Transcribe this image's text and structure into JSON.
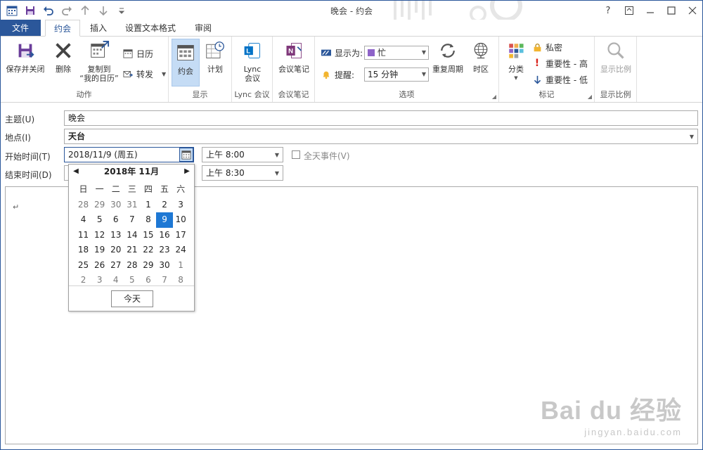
{
  "window": {
    "title": "晚会 - 约会"
  },
  "title_controls": {
    "help": "?"
  },
  "tabs": {
    "file": "文件",
    "appointment": "约会",
    "insert": "插入",
    "format_text": "设置文本格式",
    "review": "审阅"
  },
  "ribbon": {
    "actions": {
      "save_close": "保存并关闭",
      "delete": "删除",
      "copy_to_line1": "复制到",
      "copy_to_line2": "“我的日历”",
      "calendar": "日历",
      "forward": "转发",
      "group_label": "动作"
    },
    "show": {
      "appointment": "约会",
      "schedule": "计划",
      "group_label": "显示"
    },
    "lync": {
      "meeting_line1": "Lync",
      "meeting_line2": "会议",
      "group_label": "Lync 会议"
    },
    "notes": {
      "meeting_notes": "会议笔记",
      "group_label": "会议笔记"
    },
    "options": {
      "show_as_label": "显示为:",
      "show_as_value": "忙",
      "reminder_label": "提醒:",
      "reminder_value": "15 分钟",
      "recurrence": "重复周期",
      "timezone": "时区",
      "group_label": "选项"
    },
    "tags": {
      "categorize": "分类",
      "private": "私密",
      "high_importance": "重要性 - 高",
      "low_importance": "重要性 - 低",
      "group_label": "标记"
    },
    "zoom": {
      "zoom": "显示比例",
      "group_label": "显示比例"
    }
  },
  "form": {
    "subject_label": "主题(U)",
    "subject_value": "晚会",
    "location_label": "地点(I)",
    "location_value": "天台",
    "start_label": "开始时间(T)",
    "start_date": "2018/11/9 (周五)",
    "start_time": "上午 8:00",
    "all_day_label": "全天事件(V)",
    "end_label": "结束时间(D)",
    "end_time": "上午 8:30"
  },
  "body": {
    "paragraph_mark": "↵"
  },
  "calendar": {
    "header": "2018年 11月",
    "weekdays": [
      "日",
      "一",
      "二",
      "三",
      "四",
      "五",
      "六"
    ],
    "weeks": [
      [
        {
          "d": "28",
          "dim": true
        },
        {
          "d": "29",
          "dim": true
        },
        {
          "d": "30",
          "dim": true
        },
        {
          "d": "31",
          "dim": true
        },
        {
          "d": "1"
        },
        {
          "d": "2"
        },
        {
          "d": "3"
        }
      ],
      [
        {
          "d": "4"
        },
        {
          "d": "5"
        },
        {
          "d": "6"
        },
        {
          "d": "7"
        },
        {
          "d": "8"
        },
        {
          "d": "9",
          "sel": true
        },
        {
          "d": "10"
        }
      ],
      [
        {
          "d": "11"
        },
        {
          "d": "12"
        },
        {
          "d": "13"
        },
        {
          "d": "14"
        },
        {
          "d": "15"
        },
        {
          "d": "16"
        },
        {
          "d": "17"
        }
      ],
      [
        {
          "d": "18"
        },
        {
          "d": "19"
        },
        {
          "d": "20"
        },
        {
          "d": "21"
        },
        {
          "d": "22"
        },
        {
          "d": "23"
        },
        {
          "d": "24"
        }
      ],
      [
        {
          "d": "25"
        },
        {
          "d": "26"
        },
        {
          "d": "27"
        },
        {
          "d": "28"
        },
        {
          "d": "29"
        },
        {
          "d": "30"
        },
        {
          "d": "1",
          "dim": true
        }
      ],
      [
        {
          "d": "2",
          "dim": true
        },
        {
          "d": "3",
          "dim": true
        },
        {
          "d": "4",
          "dim": true
        },
        {
          "d": "5",
          "dim": true
        },
        {
          "d": "6",
          "dim": true
        },
        {
          "d": "7",
          "dim": true
        },
        {
          "d": "8",
          "dim": true
        }
      ]
    ],
    "today_button": "今天"
  },
  "watermark": {
    "main": "Bai du 经验",
    "sub": "jingyan.baidu.com"
  },
  "colors": {
    "accent": "#2b579a",
    "selected": "#1e78d4",
    "ribbon_selected": "#c5dcf5"
  }
}
